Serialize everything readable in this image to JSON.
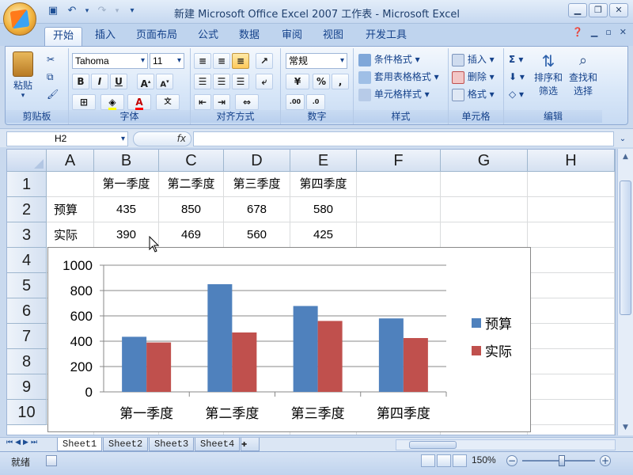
{
  "window": {
    "title": "新建 Microsoft Office Excel 2007 工作表 - Microsoft Excel"
  },
  "tabs": [
    "开始",
    "插入",
    "页面布局",
    "公式",
    "数据",
    "审阅",
    "视图",
    "开发工具"
  ],
  "ribbon": {
    "clipboard": {
      "paste": "粘贴",
      "label": "剪贴板"
    },
    "font": {
      "name": "Tahoma",
      "size": "11",
      "label": "字体",
      "bold": "B",
      "italic": "I",
      "underline": "U"
    },
    "alignment": {
      "label": "对齐方式"
    },
    "number": {
      "format": "常规",
      "label": "数字",
      "percent": "%",
      "comma": ","
    },
    "styles": {
      "conditional": "条件格式",
      "table": "套用表格格式",
      "cell": "单元格样式",
      "label": "样式"
    },
    "cells": {
      "insert": "插入",
      "delete": "删除",
      "format": "格式",
      "label": "单元格"
    },
    "editing": {
      "sort": "排序和\n筛选",
      "sort1": "排序和",
      "sort2": "筛选",
      "find1": "查找和",
      "find2": "选择",
      "label": "编辑"
    }
  },
  "formula_bar": {
    "name_box": "H2",
    "fx": "fx",
    "value": ""
  },
  "columns": [
    "A",
    "B",
    "C",
    "D",
    "E",
    "F",
    "G",
    "H"
  ],
  "rows": [
    "1",
    "2",
    "3",
    "4",
    "5",
    "6",
    "7",
    "8",
    "9",
    "10"
  ],
  "cells": {
    "B1": "第一季度",
    "C1": "第二季度",
    "D1": "第三季度",
    "E1": "第四季度",
    "A2": "预算",
    "B2": "435",
    "C2": "850",
    "D2": "678",
    "E2": "580",
    "A3": "实际",
    "B3": "390",
    "C3": "469",
    "D3": "560",
    "E3": "425"
  },
  "chart_data": {
    "type": "bar",
    "categories": [
      "第一季度",
      "第二季度",
      "第三季度",
      "第四季度"
    ],
    "series": [
      {
        "name": "预算",
        "values": [
          435,
          850,
          678,
          580
        ],
        "color": "#4f81bd"
      },
      {
        "name": "实际",
        "values": [
          390,
          469,
          560,
          425
        ],
        "color": "#c0504d"
      }
    ],
    "ylim": [
      0,
      1000
    ],
    "yticks": [
      0,
      200,
      400,
      600,
      800,
      1000
    ],
    "grid": true,
    "legend": "right"
  },
  "sheets": [
    "Sheet1",
    "Sheet2",
    "Sheet3",
    "Sheet4"
  ],
  "status": {
    "text": "就绪",
    "zoom": "150%"
  }
}
